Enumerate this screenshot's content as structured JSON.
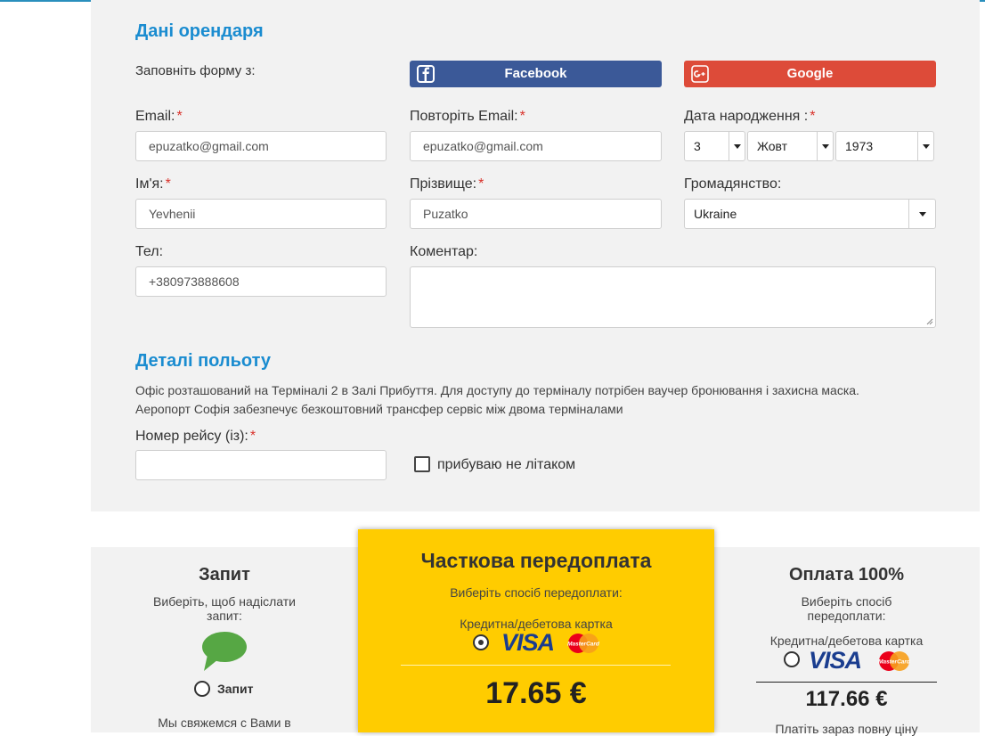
{
  "renter": {
    "title": "Дані орендаря",
    "fill_with": "Заповніть форму з:",
    "facebook_label": "Facebook",
    "google_label": "Google",
    "email_label": "Email:",
    "email_value": "epuzatko@gmail.com",
    "repeat_email_label": "Повторіть Email:",
    "repeat_email_value": "epuzatko@gmail.com",
    "birth_label": "Дата народження :",
    "birth_day": "3",
    "birth_month": "Жовт",
    "birth_year": "1973",
    "name_label": "Ім'я:",
    "name_value": "Yevhenii",
    "surname_label": "Прізвище:",
    "surname_value": "Puzatko",
    "citizenship_label": "Громадянство:",
    "citizenship_value": "Ukraine",
    "phone_label": "Тел:",
    "phone_value": "+380973888608",
    "comment_label": "Коментар:",
    "required_mark": "*"
  },
  "flight": {
    "title": "Деталі польоту",
    "desc_line1": "Офіс розташований на Терміналі 2 в Залі Прибуття. Для доступу до терміналу потрібен ваучер бронювання і захисна маска.",
    "desc_line2": "Аеропорт Софія забезпечує безкоштовний трансфер сервіс між двома терміналами",
    "flight_number_label": "Номер рейсу (із):",
    "not_plane_label": "прибуваю не літаком"
  },
  "payment": {
    "request": {
      "title": "Запит",
      "sub_line1": "Виберіть, щоб надіслати",
      "sub_line2": "запит:",
      "option_label": "Запит",
      "note": "Мы свяжемся с Вами в"
    },
    "partial": {
      "title": "Часткова передоплата",
      "sub": "Виберіть спосіб передоплати:",
      "card_label": "Кредитна/дебетова картка",
      "price": "17.65 €"
    },
    "full": {
      "title": "Оплата 100%",
      "sub_line1": "Виберіть спосіб",
      "sub_line2": "передоплати:",
      "card_label": "Кредитна/дебетова картка",
      "price": "117.66 €",
      "note": "Платіть зараз повну ціну"
    },
    "visa_text": "VISA",
    "mastercard_text": "MasterCard"
  },
  "colors": {
    "accent": "#1a8cd0",
    "facebook": "#3b5998",
    "google": "#dd4b39",
    "highlight": "#ffcc00",
    "required": "#d9322b"
  }
}
